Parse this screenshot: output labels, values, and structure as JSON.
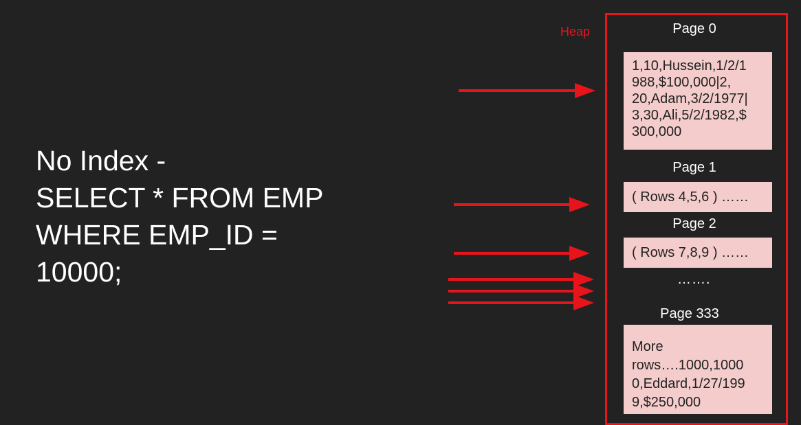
{
  "query": {
    "lines": [
      "No Index -",
      "SELECT * FROM EMP",
      "WHERE EMP_ID =",
      "10000;"
    ]
  },
  "heap": {
    "label": "Heap",
    "pages": [
      {
        "label": "Page 0",
        "content": [
          "1,10,Hussein,1/2/1",
          "988,$100,000|2,",
          "20,Adam,3/2/1977|",
          "3,30,Ali,5/2/1982,$",
          "300,000"
        ]
      },
      {
        "label": "Page 1",
        "content": [
          "( Rows 4,5,6 ) ……"
        ]
      },
      {
        "label": "Page 2",
        "content": [
          "( Rows 7,8,9 ) ……"
        ]
      },
      {
        "label": "Page 333",
        "content": [
          "More",
          "rows….1000,1000",
          "0,Eddard,1/27/199",
          "9,$250,000"
        ]
      }
    ],
    "ellipsis": "……."
  },
  "colors": {
    "background": "#222222",
    "accent_red": "#e8141b",
    "page_fill": "#f4cccc",
    "text": "#ffffff"
  }
}
